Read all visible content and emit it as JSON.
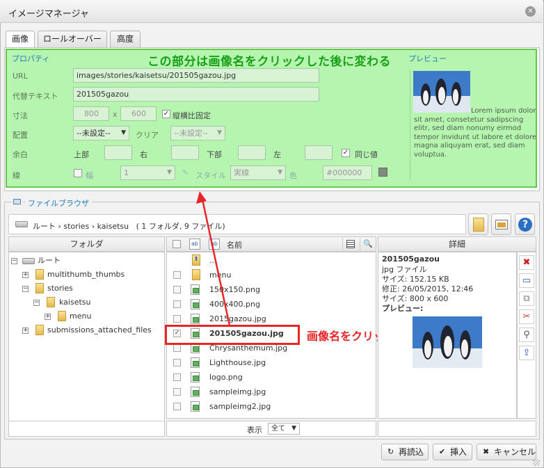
{
  "window": {
    "title": "イメージマネージャ"
  },
  "tabs": [
    {
      "label": "画像",
      "active": true
    },
    {
      "label": "ロールオーバー",
      "active": false
    },
    {
      "label": "高度",
      "active": false
    }
  ],
  "properties": {
    "section_label": "プロパティ",
    "url_label": "URL",
    "url_value": "images/stories/kaisetsu/201505gazou.jpg",
    "alt_label": "代替テキスト",
    "alt_value": "201505gazou",
    "size_label": "寸法",
    "width": "800",
    "size_x": "x",
    "height": "600",
    "keep_ratio_label": "縦横比固定",
    "keep_ratio_checked": true,
    "align_label": "配置",
    "align_value": "--未設定--",
    "clear_label": "クリア",
    "clear_value": "--未設定--",
    "margin_label": "余白",
    "margin_top": "上部",
    "margin_right": "右",
    "margin_bottom": "下部",
    "margin_left": "左",
    "margin_same_label": "同じ値",
    "margin_same_checked": true,
    "border_label": "線",
    "border_width_label": "幅",
    "border_width_value": "1",
    "border_style_label": "スタイル",
    "border_style_value": "実線",
    "border_color_label": "色",
    "border_color_value": "#000000"
  },
  "annotation_top": "この部分は画像名をクリックした後に変わる",
  "preview": {
    "section_label": "プレビュー",
    "lorem": "Lorem ipsum dolor sit amet, consetetur sadipscing elitr, sed diam nonumy eirmod tempor invidunt ut labore et dolore magna aliquyam erat, sed diam voluptua."
  },
  "file_browser": {
    "legend": "ファイルブラウザ",
    "breadcrumb": "ルート › stories › kaisetsu",
    "summary": "( 1 フォルダ, 9 ファイル)",
    "folder_header": "フォルダ",
    "name_header": "名前",
    "details_header": "詳細",
    "tree": [
      {
        "label": "ルート",
        "toggle": "−"
      },
      {
        "label": "multithumb_thumbs",
        "toggle": "+"
      },
      {
        "label": "stories",
        "toggle": "−"
      },
      {
        "label": "kaisetsu",
        "toggle": "−"
      },
      {
        "label": "menu",
        "toggle": "+"
      },
      {
        "label": "submissions_attached_files",
        "toggle": "+"
      }
    ],
    "files": [
      {
        "name": "...",
        "kind": "up"
      },
      {
        "name": "menu",
        "kind": "folder"
      },
      {
        "name": "150x150.png",
        "kind": "image"
      },
      {
        "name": "400x400.png",
        "kind": "image"
      },
      {
        "name": "2015gazou.jpg",
        "kind": "image"
      },
      {
        "name": "201505gazou.jpg",
        "kind": "image",
        "selected": true
      },
      {
        "name": "Chrysanthemum.jpg",
        "kind": "image"
      },
      {
        "name": "Lighthouse.jpg",
        "kind": "image"
      },
      {
        "name": "logo.png",
        "kind": "image"
      },
      {
        "name": "sampleimg.jpg",
        "kind": "image"
      },
      {
        "name": "sampleimg2.jpg",
        "kind": "image"
      }
    ],
    "display_label": "表示",
    "display_value": "全て",
    "details": {
      "title": "201505gazou",
      "type": "jpg ファイル",
      "filesize": "サイズ: 152.15 KB",
      "modified": "修正: 26/05/2015, 12:46",
      "dimensions": "サイズ: 800 x 600",
      "preview_label": "プレビュー:"
    }
  },
  "annotation_click": "画像名をクリック",
  "buttons": {
    "reload": "再読込",
    "insert": "挿入",
    "cancel": "キャンセル"
  },
  "colors": {
    "highlight_green": "#b6f5b0",
    "annotation_green": "#18a018",
    "annotation_red": "#e8262a",
    "link_blue": "#1c7ab6"
  }
}
